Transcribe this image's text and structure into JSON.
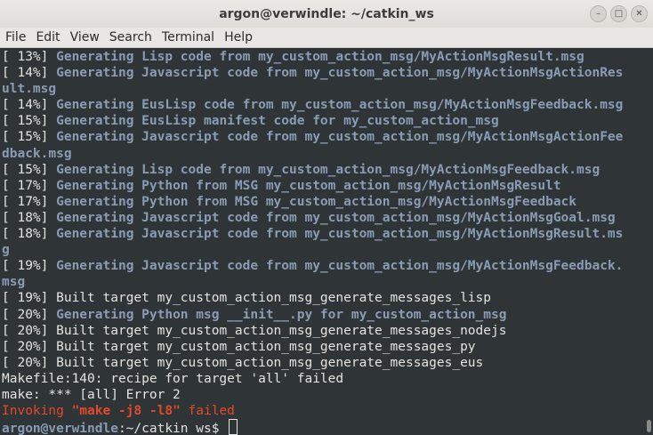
{
  "window": {
    "title": "argon@verwindle: ~/catkin_ws",
    "controls": {
      "minimize": "–",
      "maximize": "□",
      "close": "✕"
    }
  },
  "menu": [
    "File",
    "Edit",
    "View",
    "Search",
    "Terminal",
    "Help"
  ],
  "terminal": {
    "lines": [
      {
        "pct": "[ 13%]",
        "msg": " Generating Lisp code from my_custom_action_msg/MyActionMsgResult.msg",
        "style": "gen"
      },
      {
        "pct": "[ 14%]",
        "msg": " Generating Javascript code from my_custom_action_msg/MyActionMsgActionRes",
        "style": "gen"
      },
      {
        "pct": "",
        "msg": "ult.msg",
        "style": "gen"
      },
      {
        "pct": "[ 14%]",
        "msg": " Generating EusLisp code from my_custom_action_msg/MyActionMsgFeedback.msg",
        "style": "gen"
      },
      {
        "pct": "[ 15%]",
        "msg": " Generating EusLisp manifest code for my_custom_action_msg",
        "style": "gen"
      },
      {
        "pct": "[ 15%]",
        "msg": " Generating Javascript code from my_custom_action_msg/MyActionMsgActionFee",
        "style": "gen"
      },
      {
        "pct": "",
        "msg": "dback.msg",
        "style": "gen"
      },
      {
        "pct": "[ 15%]",
        "msg": " Generating Lisp code from my_custom_action_msg/MyActionMsgFeedback.msg",
        "style": "gen"
      },
      {
        "pct": "[ 17%]",
        "msg": " Generating Python from MSG my_custom_action_msg/MyActionMsgResult",
        "style": "gen"
      },
      {
        "pct": "[ 17%]",
        "msg": " Generating Python from MSG my_custom_action_msg/MyActionMsgFeedback",
        "style": "gen"
      },
      {
        "pct": "[ 18%]",
        "msg": " Generating Javascript code from my_custom_action_msg/MyActionMsgGoal.msg",
        "style": "gen"
      },
      {
        "pct": "[ 18%]",
        "msg": " Generating Javascript code from my_custom_action_msg/MyActionMsgResult.ms",
        "style": "gen"
      },
      {
        "pct": "",
        "msg": "g",
        "style": "gen"
      },
      {
        "pct": "[ 19%]",
        "msg": " Generating Javascript code from my_custom_action_msg/MyActionMsgFeedback.",
        "style": "gen"
      },
      {
        "pct": "",
        "msg": "msg",
        "style": "gen"
      },
      {
        "pct": "[ 19%]",
        "msg": " Built target my_custom_action_msg_generate_messages_lisp",
        "style": "tx"
      },
      {
        "pct": "[ 20%]",
        "msg": " Generating Python msg __init__.py for my_custom_action_msg",
        "style": "gen"
      },
      {
        "pct": "[ 20%]",
        "msg": " Built target my_custom_action_msg_generate_messages_nodejs",
        "style": "tx"
      },
      {
        "pct": "[ 20%]",
        "msg": " Built target my_custom_action_msg_generate_messages_py",
        "style": "tx"
      },
      {
        "pct": "[ 20%]",
        "msg": " Built target my_custom_action_msg_generate_messages_eus",
        "style": "tx"
      },
      {
        "pct": "",
        "msg": "Makefile:140: recipe for target 'all' failed",
        "style": "tx"
      },
      {
        "pct": "",
        "msg": "make: *** [all] Error 2",
        "style": "tx"
      }
    ],
    "error_line": {
      "pre": "Invoking ",
      "quoted": "\"make -j8 -l8\"",
      "post": " failed"
    },
    "prompt": {
      "user_host": "argon@verwindle",
      "path": ":~/catkin_ws$ "
    }
  }
}
